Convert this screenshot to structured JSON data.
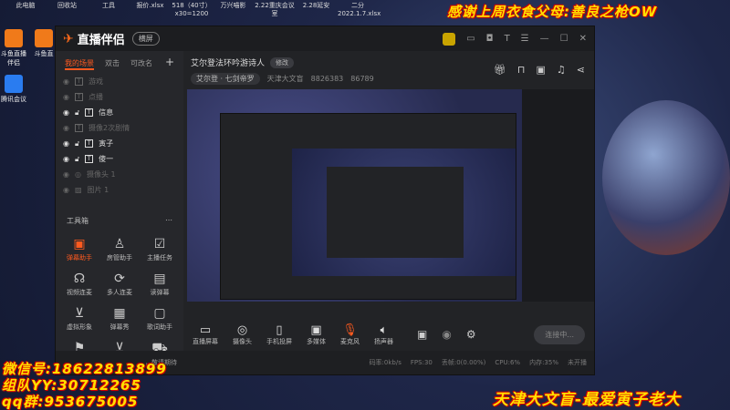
{
  "desktop": {
    "top_icons": [
      "此电脑",
      "回收站",
      "工具",
      "报价.xlsx",
      "518（40寸）x30=1200",
      "万兴喵影",
      "2.22重庆会议室",
      "2.28延安",
      "二分 2022.1.7.xlsx"
    ],
    "side_icons": [
      "斗鱼直播伴侣",
      "斗鱼直",
      "腾讯会议"
    ]
  },
  "overlay": {
    "thanks": "感谢上周衣食父母:善良之枪OW",
    "contact": [
      "微信号:18622813899",
      "组队YY:30712265",
      "qq群:953675005"
    ],
    "slogan": "天津大文盲-最爱寅子老大"
  },
  "app": {
    "name": "直播伴侣",
    "mode": "横屏",
    "titlebar_icons": [
      "monitor-icon",
      "skin-icon",
      "shirt-icon",
      "menu-icon",
      "minimize-icon",
      "maximize-icon",
      "close-icon"
    ],
    "tabs": [
      "我的场景",
      "双击",
      "可改名"
    ],
    "scenes": [
      {
        "label": "游戏",
        "visible": false
      },
      {
        "label": "点播",
        "visible": false
      },
      {
        "label": "信息",
        "visible": true
      },
      {
        "label": "摄像2次剧情",
        "visible": false
      },
      {
        "label": "寅子",
        "visible": true
      },
      {
        "label": "傻一",
        "visible": true
      },
      {
        "label": "摄像头 1",
        "visible": false
      },
      {
        "label": "图片 1",
        "visible": false
      }
    ],
    "toolbox_title": "工具箱",
    "tools": [
      "弹幕助手",
      "房管助手",
      "主播任务",
      "视频连麦",
      "多人连麦",
      "读弹幕",
      "虚拟形象",
      "弹幕秀",
      "歌词助手",
      "",
      "",
      ""
    ],
    "stream_title": "艾尔登法环吟游诗人",
    "edit_tag": "修改",
    "category": "艾尔登 · 七剑帝罗",
    "room_name": "天津大文盲",
    "room_id": "8826383",
    "followers": "86789",
    "bottom": [
      "直播屏幕",
      "摄像头",
      "手机投屏",
      "多媒体",
      "麦克风",
      "扬声器"
    ],
    "live_button": "连接中...",
    "notice": "，敬请期待",
    "status": {
      "bitrate": "码率:0kb/s",
      "fps": "FPS:30",
      "drop": "丢帧:0(0.00%)",
      "cpu": "CPU:6%",
      "mem": "内存:35%",
      "state": "未开播"
    }
  }
}
